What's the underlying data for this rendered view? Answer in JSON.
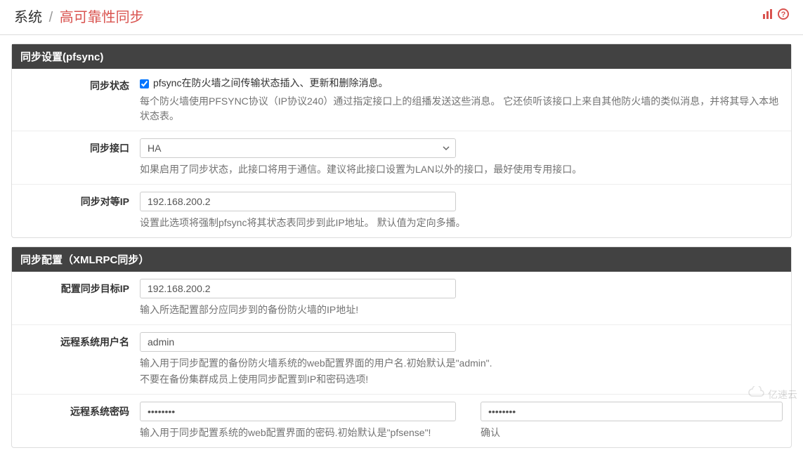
{
  "breadcrumb": {
    "root": "系统",
    "sep": "/",
    "active": "高可靠性同步"
  },
  "panel1": {
    "title": "同步设置(pfsync)",
    "sync_state": {
      "label": "同步状态",
      "checkbox_label": "pfsync在防火墙之间传输状态插入、更新和删除消息。",
      "help": "每个防火墙使用PFSYNC协议（IP协议240）通过指定接口上的组播发送这些消息。 它还侦听该接口上来自其他防火墙的类似消息，并将其导入本地状态表。"
    },
    "sync_iface": {
      "label": "同步接口",
      "value": "HA",
      "help": "如果启用了同步状态，此接口将用于通信。建议将此接口设置为LAN以外的接口，最好使用专用接口。"
    },
    "sync_peer": {
      "label": "同步对等IP",
      "value": "192.168.200.2",
      "help": "设置此选项将强制pfsync将其状态表同步到此IP地址。 默认值为定向多播。"
    }
  },
  "panel2": {
    "title": "同步配置（XMLRPC同步）",
    "target_ip": {
      "label": "配置同步目标IP",
      "value": "192.168.200.2",
      "help": "输入所选配置部分应同步到的备份防火墙的IP地址!"
    },
    "username": {
      "label": "远程系统用户名",
      "value": "admin",
      "help1": "输入用于同步配置的备份防火墙系统的web配置界面的用户名.初始默认是\"admin\".",
      "help2": "不要在备份集群成员上使用同步配置到IP和密码选项!"
    },
    "password": {
      "label": "远程系统密码",
      "value": "••••••••",
      "confirm_value": "••••••••",
      "confirm_label": "确认",
      "help": "输入用于同步配置系统的web配置界面的密码.初始默认是\"pfsense\"!"
    }
  },
  "watermark": "亿速云"
}
